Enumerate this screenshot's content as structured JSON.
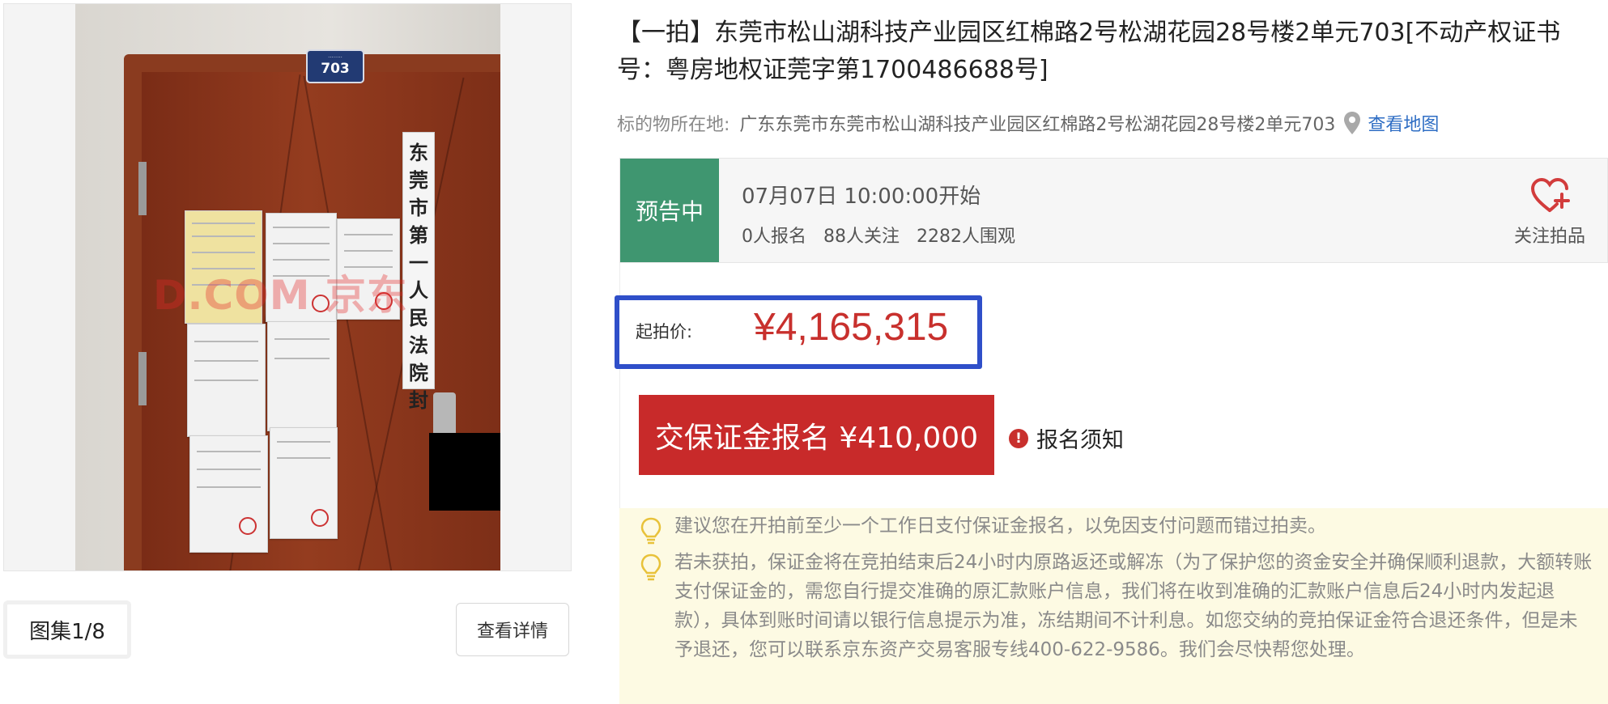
{
  "gallery": {
    "counter": "图集1/8",
    "detail_button": "查看详情",
    "photo": {
      "plate_number": "703",
      "seal_text": [
        "东",
        "莞",
        "市",
        "第",
        "一",
        "人",
        "民",
        "法",
        "院",
        "封"
      ],
      "watermark": "D.COM 京东"
    }
  },
  "listing": {
    "title": "【一拍】东莞市松山湖科技产业园区红棉路2号松湖花园28号楼2单元703[不动产权证书号：粤房地权证莞字第1700486688号]",
    "location_label": "标的物所在地:",
    "location_value": "广东东莞市东莞市松山湖科技产业园区红棉路2号松湖花园28号楼2单元703",
    "map_link": "查看地图"
  },
  "status": {
    "badge": "预告中",
    "start_time": "07月07日 10:00:00开始",
    "registrations": "0人报名",
    "followers": "88人关注",
    "views": "2282人围观",
    "follow_label": "关注拍品"
  },
  "price": {
    "label": "起拍价:",
    "value": "¥4,165,315"
  },
  "actions": {
    "deposit_button": "交保证金报名 ¥410,000",
    "notice_link": "报名须知"
  },
  "tips": [
    "建议您在开拍前至少一个工作日支付保证金报名，以免因支付问题而错过拍卖。",
    "若未获拍，保证金将在竞拍结束后24小时内原路返还或解冻（为了保护您的资金安全并确保顺利退款，大额转账支付保证金的，需您自行提交准确的原汇款账户信息，我们将在收到准确的汇款账户信息后24小时内发起退款），具体到账时间请以银行信息提示为准，冻结期间不计利息。如您交纳的竞拍保证金符合退还条件，但是未予退还，您可以联系京东资产交易客服专线400-622-9586。我们会尽快帮您处理。"
  ],
  "colors": {
    "status_green": "#3f9670",
    "price_red": "#c8302d",
    "button_red": "#c82a2a",
    "highlight_blue": "#2f4fc9",
    "link_blue": "#2f6ec4",
    "tips_bg": "#fdfae3"
  },
  "icons": [
    "pin-icon",
    "heart-plus-icon",
    "alert-icon",
    "bulb-icon"
  ]
}
